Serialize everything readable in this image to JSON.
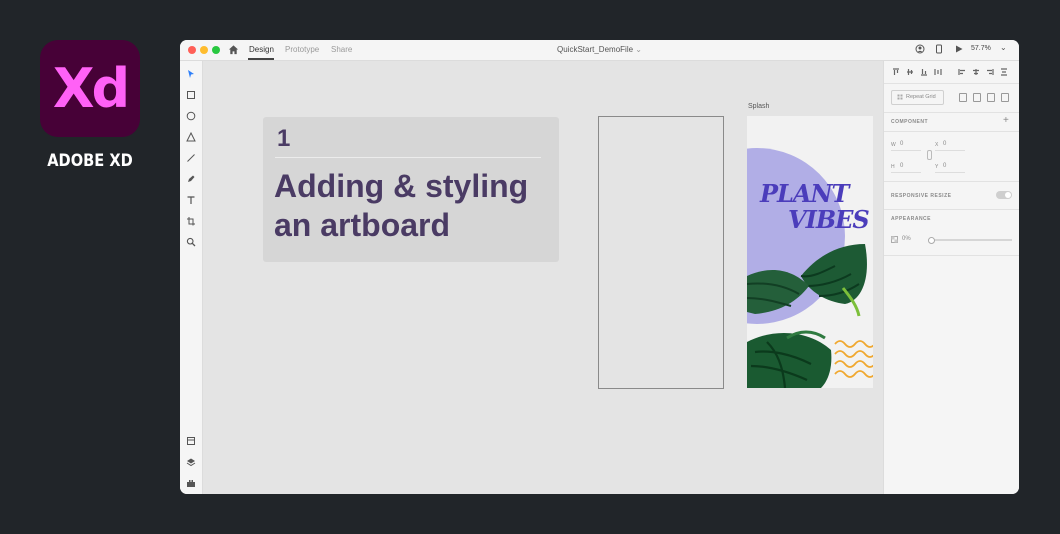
{
  "brand": {
    "logo_text": "Xd",
    "name": "ADOBE XD"
  },
  "titlebar": {
    "tabs": [
      {
        "label": "Design",
        "active": true
      },
      {
        "label": "Prototype"
      },
      {
        "label": "Share"
      }
    ],
    "document_title": "QuickStart_DemoFile",
    "zoom": "57.7%"
  },
  "tools": [
    "select-icon",
    "rectangle-icon",
    "ellipse-icon",
    "polygon-icon",
    "line-icon",
    "pen-icon",
    "text-icon",
    "artboard-icon",
    "zoom-icon"
  ],
  "bottom_tools": [
    "assets-icon",
    "layers-icon",
    "plugins-icon"
  ],
  "canvas": {
    "lesson": {
      "number": "1",
      "title": "Adding & styling an artboard"
    },
    "splash_label": "Splash",
    "splash_text_1": "PLANT",
    "splash_text_2": "VIBES"
  },
  "inspector": {
    "repeat_grid": "Repeat Grid",
    "component_label": "COMPONENT",
    "w_label": "W",
    "w_value": "0",
    "x_label": "X",
    "x_value": "0",
    "h_label": "H",
    "h_value": "0",
    "y_label": "Y",
    "y_value": "0",
    "responsive_label": "RESPONSIVE RESIZE",
    "appearance_label": "APPEARANCE",
    "opacity_value": "0%"
  },
  "colors": {
    "brand_bg": "#470137",
    "brand_fg": "#ff61f6",
    "lesson_text": "#4a3b64",
    "splash_text": "#4b3dbb",
    "splash_circle": "#b1aee6",
    "wave": "#f0a830"
  }
}
